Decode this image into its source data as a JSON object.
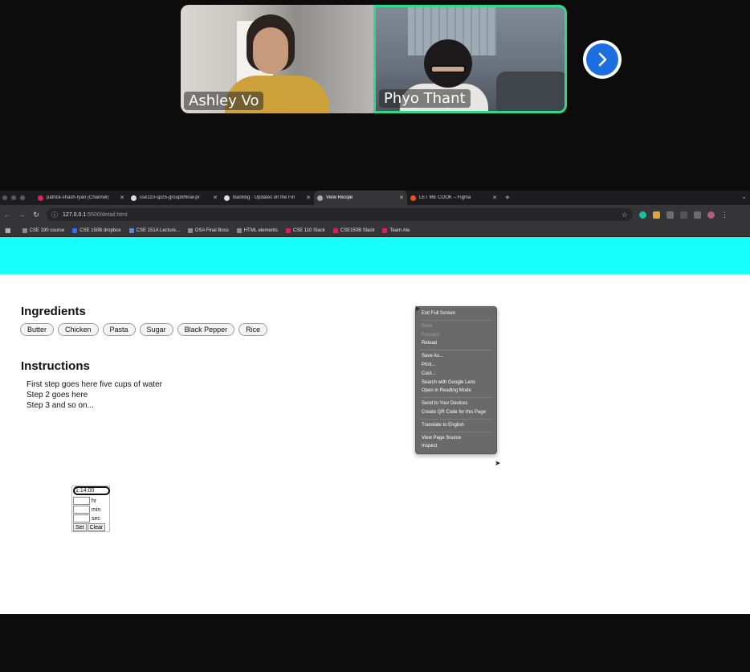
{
  "call": {
    "participants": [
      {
        "name": "Ashley Vo"
      },
      {
        "name": "Phyo Thant"
      }
    ],
    "next_icon": "chevron-right-icon",
    "active_speaker_color": "#2fd88a",
    "next_button_color": "#1c6fe0"
  },
  "browser": {
    "tabs": [
      {
        "label": "patrick-shash-ryan (Channel)",
        "icon": "slack-icon",
        "active": false
      },
      {
        "label": "cse110-sp25-group8/final-pr",
        "icon": "github-icon",
        "active": false
      },
      {
        "label": "Backlog · Updates on the Fin",
        "icon": "github-icon",
        "active": false
      },
      {
        "label": "View Recipe",
        "icon": "globe-icon",
        "active": true
      },
      {
        "label": "LET ME COOK – Figma",
        "icon": "figma-icon",
        "active": false
      }
    ],
    "new_tab": "+",
    "url_host": "127.0.0.1",
    "url_rest": ":5500/detail.html",
    "bookmarks": [
      "CSE 190 course",
      "CSE 150B dropbox",
      "CSE 151A Lecture...",
      "DSA Final Boss",
      "HTML elements",
      "CSE 110 Slack",
      "CSE150B Slack",
      "Team Ate"
    ]
  },
  "page": {
    "header_color": "#16fffb",
    "ingredients_title": "Ingredients",
    "ingredients": [
      "Butter",
      "Chicken",
      "Pasta",
      "Sugar",
      "Black Pepper",
      "Rice"
    ],
    "instructions_title": "Instructions",
    "steps": [
      "First step goes here five cups of water",
      "Step 2 goes here",
      "Step 3 and so on..."
    ],
    "timer": {
      "display": "1:14:00",
      "hr_label": "hr",
      "min_label": "min",
      "sec_label": "sec",
      "set_label": "Set",
      "clear_label": "Clear"
    }
  },
  "context_menu": {
    "items": [
      {
        "label": "Exit Full Screen",
        "enabled": true
      },
      {
        "sep": true
      },
      {
        "label": "Back",
        "enabled": false
      },
      {
        "label": "Forward",
        "enabled": false
      },
      {
        "label": "Reload",
        "enabled": true
      },
      {
        "sep": true
      },
      {
        "label": "Save As...",
        "enabled": true
      },
      {
        "label": "Print...",
        "enabled": true
      },
      {
        "label": "Cast...",
        "enabled": true
      },
      {
        "label": "Search with Google Lens",
        "enabled": true
      },
      {
        "label": "Open in Reading Mode",
        "enabled": true
      },
      {
        "sep": true
      },
      {
        "label": "Send to Your Devices",
        "enabled": true
      },
      {
        "label": "Create QR Code for this Page",
        "enabled": true
      },
      {
        "sep": true
      },
      {
        "label": "Translate to English",
        "enabled": true
      },
      {
        "sep": true
      },
      {
        "label": "View Page Source",
        "enabled": true
      },
      {
        "label": "Inspect",
        "enabled": true
      }
    ]
  }
}
